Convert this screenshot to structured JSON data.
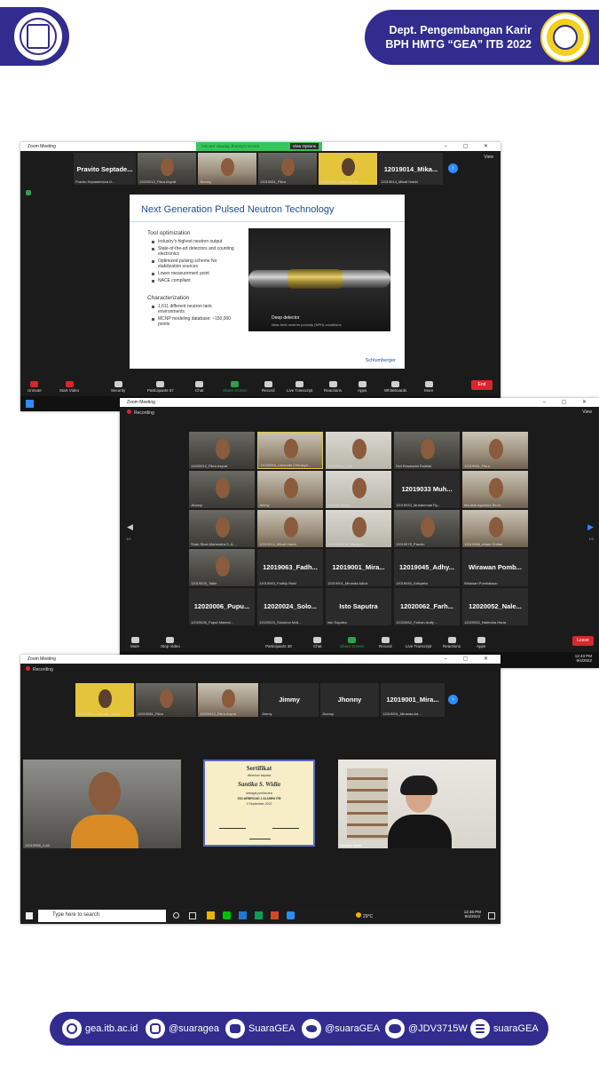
{
  "header": {
    "title_line1": "Dept. Pengembangan Karir",
    "title_line2": "BPH HMTG “GEA” ITB 2022",
    "left_logo": "institut-teknologi-bandung-seal",
    "right_logo": "hmtg-gea-logo"
  },
  "shot1": {
    "window_title": "Zoom Meeting",
    "banner": "You are viewing Jhonny's screen",
    "view_options": "View Options",
    "view_label": "View",
    "strip": [
      {
        "big": "Pravito  Septade...",
        "name": "Pravito Septaderiova D..."
      },
      {
        "name": "12020012_Fikra Asyraf"
      },
      {
        "name": "Jhonny"
      },
      {
        "name": "12019081_Fikra"
      },
      {
        "name": "12020054_Laksmita Ch..."
      },
      {
        "big": "12019014_Mika...",
        "name": "12019014_Mikail Haidri"
      }
    ],
    "slide": {
      "title": "Next Generation Pulsed Neutron Technology",
      "h1": "Tool optimization",
      "bullets1": [
        "Industry's highest neutron output",
        "State-of-the-art detectors and counting electronics",
        "Optimized pulsing scheme No stabilization sources",
        "Lower measurement point",
        "NACE compliant"
      ],
      "h2": "Characterization",
      "bullets2": [
        "1,611 different neutron tank environments",
        "MCNP modeling database: ~150,000 points"
      ],
      "caption": "Deep detector",
      "caption2": "Near-field neutron porosity (NPH) conditions",
      "brand": "Schlumberger"
    },
    "toolbar": [
      "Unmute",
      "Start Video",
      "Security",
      "Participants",
      "Chat",
      "Share Screen",
      "Record",
      "Live Transcript",
      "Reactions",
      "Apps",
      "Whiteboards",
      "More"
    ],
    "participants_count": "67",
    "end": "End"
  },
  "shot2": {
    "window_title": "Zoom Meeting",
    "recording": "Recording",
    "view_label": "View",
    "page_left": "1/2",
    "page_right": "1/2",
    "grid": [
      {
        "name": "12020012_Fikra Asyraf"
      },
      {
        "name": "12020054_Laksmita Chitrasyo..."
      },
      {
        "name": "12019056_Lutfi"
      },
      {
        "name": "Seli Rosmarini Fadhila"
      },
      {
        "name": "12019081_Fikra"
      },
      {
        "name": "Jhonny"
      },
      {
        "name": "Jimmy"
      },
      {
        "name": "Santika Widia"
      },
      {
        "big": "12019033  Muh...",
        "name": "12019033_Muhammad Ry..."
      },
      {
        "name": "Maulida Agustina Siroh..."
      },
      {
        "name": "Shan Shan Mahendra S. A..."
      },
      {
        "name": "12019014_Mikail Haidri"
      },
      {
        "name": "12019003_M Gilang A..."
      },
      {
        "name": "12019079_Pravito"
      },
      {
        "name": "12019068_Irfaan Ghifari"
      },
      {
        "name": "12019025_Taikir"
      },
      {
        "big": "12019063_Fadh...",
        "name": "12019063_Fadhly Rizki"
      },
      {
        "big": "12019001_Mira...",
        "name": "12019001_Miranda Adiva"
      },
      {
        "big": "12019045_Adhy...",
        "name": "12019045_Adhyatta"
      },
      {
        "big": "Wirawan  Pomb...",
        "name": "Wirawan Pombalawo"
      },
      {
        "big": "12020006_Pupu...",
        "name": "12020006_Puput Maimai..."
      },
      {
        "big": "12020024_Solo...",
        "name": "12020024_Solomon Muli..."
      },
      {
        "big": "Isto Saputra",
        "name": "Isto Saputra"
      },
      {
        "big": "12020062_Farh...",
        "name": "12020062_Farhan Arafy ..."
      },
      {
        "big": "12020052_Nale...",
        "name": "12020052_Nalendra Haria"
      }
    ],
    "toolbar": [
      "Mute",
      "Stop Video",
      "Participants",
      "Chat",
      "Share Screen",
      "Record",
      "Live Transcript",
      "Reactions",
      "Apps"
    ],
    "participants_count": "38",
    "leave": "Leave",
    "time": "12:43 PM",
    "date": "9/4/2022"
  },
  "shot3": {
    "window_title": "Zoom Meeting",
    "recording": "Recording",
    "strip": [
      {
        "name": "12020054_Laksmita Chitra..."
      },
      {
        "name": "12019081_Fikra"
      },
      {
        "name": "12020012_Fikra Asyraf"
      },
      {
        "big": "Jimmy",
        "name": "Jimmy"
      },
      {
        "big": "Jhonny",
        "name": "Jhonny"
      },
      {
        "big": "12019001_Mira...",
        "name": "12019001_Miranda Ad..."
      }
    ],
    "main_left": "12019056_Lutfi",
    "main_right": "Santika Widia",
    "certificate": {
      "title": "Sertifikat",
      "sub": "diberikan kepada",
      "name": "Santika S. Widia",
      "line": "sebagai pembicara",
      "event": "SOLARBROAD 1 ALUMNI ITB",
      "date": "4 September 2022"
    },
    "taskbar": {
      "search_placeholder": "Type here to search",
      "weather": "29°C",
      "time": "12:36 PM",
      "date": "9/4/2022"
    }
  },
  "footer": {
    "website": "gea.itb.ac.id",
    "instagram": "@suaragea",
    "youtube": "SuaraGEA",
    "twitter": "@suaraGEA",
    "line": "@JDV3715W",
    "spotify": "suaraGEA"
  }
}
